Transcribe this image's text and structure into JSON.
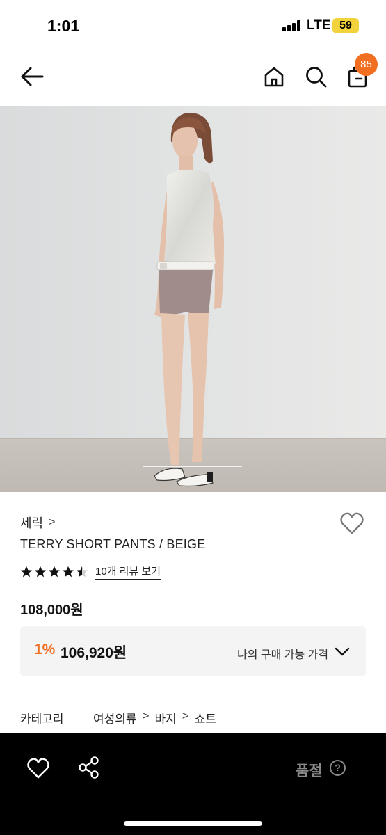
{
  "status_bar": {
    "time": "1:01",
    "network": "LTE",
    "battery": "59"
  },
  "nav": {
    "icons": [
      "arrow-left-icon",
      "home-icon",
      "search-icon",
      "shopping-bag-icon"
    ],
    "cart_count": "85"
  },
  "product": {
    "brand": "세릭",
    "brand_chevron": ">",
    "title": "TERRY SHORT PANTS / BEIGE",
    "rating": 4.5,
    "max_rating": 5,
    "review_link": "10개 리뷰 보기",
    "price": "108,000원",
    "discount": {
      "rate": "1%",
      "price": "106,920원",
      "label": "나의 구매 가능 가격"
    },
    "category": {
      "label": "카테고리",
      "path": [
        "여성의류",
        "바지",
        "쇼트"
      ],
      "separator": ">"
    }
  },
  "bottom_bar": {
    "status": "품절",
    "help": "?",
    "icons": [
      "heart-icon",
      "share-icon",
      "help-icon"
    ]
  },
  "colors": {
    "accent": "#f26f21",
    "bottom_bar_bg": "#000000",
    "discount_bg": "#f4f4f5",
    "muted": "#8a8a8a"
  }
}
